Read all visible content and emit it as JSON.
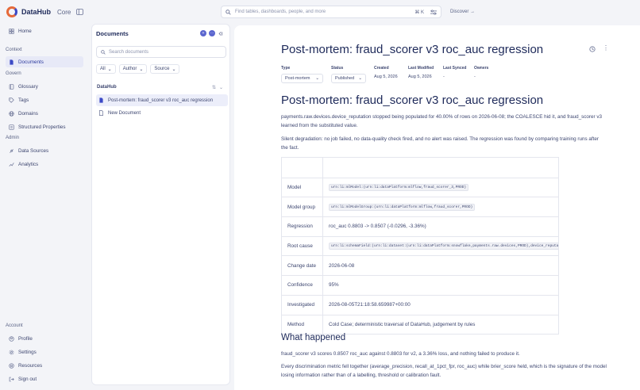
{
  "brand": {
    "name": "DataHub",
    "edition": "Core"
  },
  "search": {
    "placeholder": "Find tables, dashboards, people, and more",
    "shortcut": "⌘ K"
  },
  "discover_label": "Discover →",
  "nav": {
    "home": "Home",
    "context_label": "Context",
    "documents": "Documents",
    "govern_label": "Govern",
    "glossary": "Glossary",
    "tags": "Tags",
    "domains": "Domains",
    "structured_properties": "Structured Properties",
    "admin_label": "Admin",
    "data_sources": "Data Sources",
    "analytics": "Analytics",
    "account_label": "Account",
    "profile": "Profile",
    "settings": "Settings",
    "resources": "Resources",
    "sign_out": "Sign out"
  },
  "docs_panel": {
    "title": "Documents",
    "search_placeholder": "Search documents",
    "filters": [
      "All",
      "Author",
      "Source"
    ],
    "group": "DataHub",
    "items": [
      "Post-mortem: fraud_scorer v3 roc_auc regression",
      "New Document"
    ]
  },
  "doc": {
    "title": "Post-mortem: fraud_scorer v3 roc_auc regression",
    "props": {
      "type_label": "Type",
      "type_value": "Post-mortem",
      "status_label": "Status",
      "status_value": "Published",
      "created_label": "Created",
      "created_value": "Aug 5, 2026",
      "modified_label": "Last Modified",
      "modified_value": "Aug 5, 2026",
      "synced_label": "Last Synced",
      "synced_value": "-",
      "owners_label": "Owners",
      "owners_value": "-"
    },
    "heading": "Post-mortem: fraud_scorer v3 roc_auc regression",
    "para1_a": "payments.raw.devices.device_reputation",
    "para1_b": " stopped being populated for 40.00% of rows on 2026-06-08; the COALESCE hid it, and ",
    "para1_c": "fraud_scorer v3",
    "para1_d": " learned from the substituted value.",
    "para2": "Silent degradation: no job failed, no data-quality check fired, and no alert was raised. The regression was found by comparing training runs after the fact.",
    "table": [
      {
        "key": "Model",
        "value": "urn:li:mlModel:(urn:li:dataPlatform:mlflow,fraud_scorer_3,PROD)",
        "urn": true
      },
      {
        "key": "Model group",
        "value": "urn:li:mlModelGroup:(urn:li:dataPlatform:mlflow,fraud_scorer,PROD)",
        "urn": true
      },
      {
        "key": "Regression",
        "value": "roc_auc 0.8803 -> 0.8507 (-0.0296, -3.36%)",
        "urn": false
      },
      {
        "key": "Root cause",
        "value": "urn:li:schemaField:(urn:li:dataset:(urn:li:dataPlatform:snowflake,payments.raw.devices,PROD),device_reputation)",
        "urn": true
      },
      {
        "key": "Change date",
        "value": "2026-06-08",
        "urn": false
      },
      {
        "key": "Confidence",
        "value": "95%",
        "urn": false
      },
      {
        "key": "Investigated",
        "value": "2026-08-05T21:18:58.659987+00:00",
        "urn": false
      },
      {
        "key": "Method",
        "value": "Cold Case; deterministic traversal of DataHub, judgement by rules",
        "urn": false
      }
    ],
    "what_happened": "What happened",
    "para3": "fraud_scorer v3 scores 0.8507 roc_auc against 0.8803 for v2, a 3.36% loss, and nothing failed to produce it.",
    "para4": "Every discrimination metric fell together (average_precision, recall_at_1pct_fpr, roc_auc) while brier_score held, which is the signature of the model losing information rather than of a labelling, threshold or calibration fault."
  },
  "colors": {
    "accent": "#3b49c6",
    "brand_orange": "#e66a3a",
    "text": "#1e2a5a",
    "muted": "#5a6386"
  }
}
